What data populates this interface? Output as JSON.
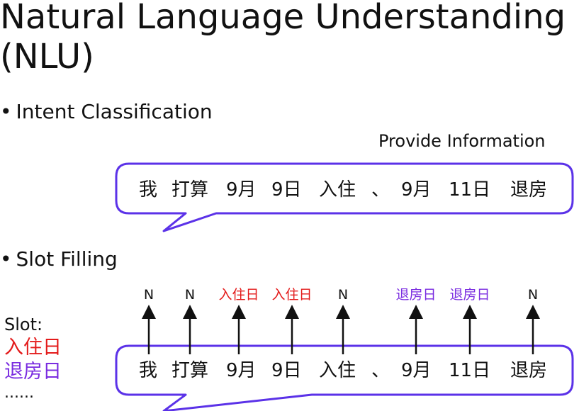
{
  "title": "Natural Language Understanding (NLU)",
  "title_line1": "Natural Language Understanding",
  "title_line2": "(NLU)",
  "bullets": {
    "intent": "Intent Classification",
    "slot": "Slot Filling"
  },
  "intent_label": "Provide Information",
  "sentence_tokens": [
    "我",
    "打算",
    "9月",
    "9日",
    "入住",
    "、",
    "9月",
    "11日",
    "退房"
  ],
  "slot_tags": [
    "N",
    "N",
    "入住日",
    "入住日",
    "N",
    "退房日",
    "退房日",
    "N"
  ],
  "slot_legend": {
    "label": "Slot:",
    "items": [
      {
        "text": "入住日",
        "color": "#e31b1b"
      },
      {
        "text": "退房日",
        "color": "#7a2ce0"
      }
    ],
    "more": "......"
  },
  "colors": {
    "bubble_stroke": "#5b32e8",
    "text": "#111111",
    "tag_n": "#111111",
    "checkin": "#e31b1b",
    "checkout": "#7a2ce0",
    "arrow": "#111111"
  }
}
